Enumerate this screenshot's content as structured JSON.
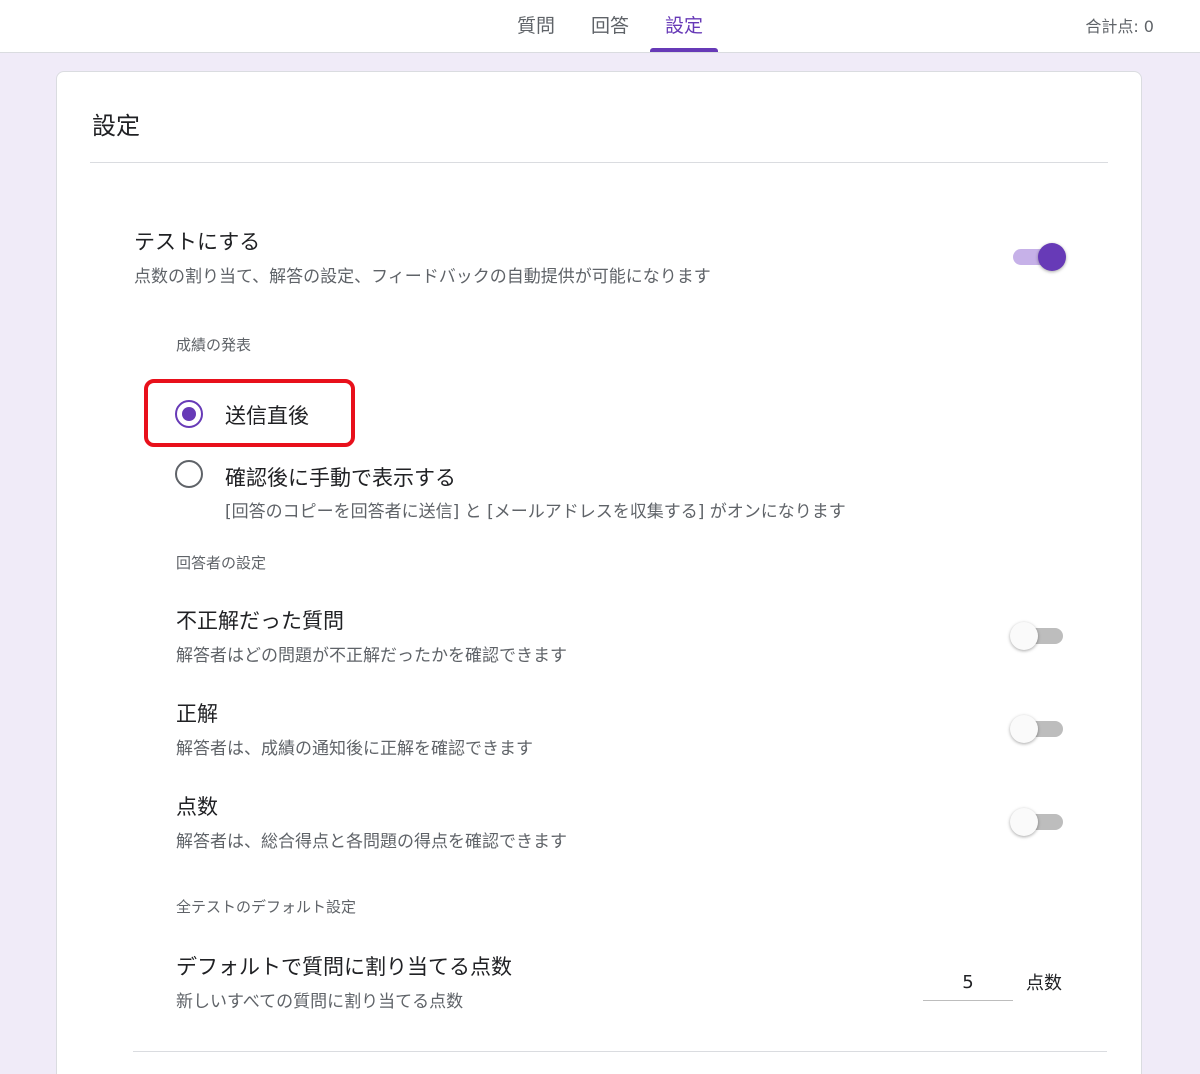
{
  "header": {
    "tabs": [
      {
        "label": "質問",
        "active": false
      },
      {
        "label": "回答",
        "active": false
      },
      {
        "label": "設定",
        "active": true
      }
    ],
    "total_points": "合計点: 0"
  },
  "settings": {
    "title": "設定",
    "quiz_mode": {
      "title": "テストにする",
      "description": "点数の割り当て、解答の設定、フィードバックの自動提供が可能になります",
      "enabled": true
    },
    "release_grade": {
      "section_label": "成績の発表",
      "options": [
        {
          "label": "送信直後",
          "selected": true,
          "description": ""
        },
        {
          "label": "確認後に手動で表示する",
          "selected": false,
          "description": "[回答のコピーを回答者に送信] と [メールアドレスを収集する] がオンになります"
        }
      ]
    },
    "respondent": {
      "section_label": "回答者の設定",
      "items": [
        {
          "title": "不正解だった質問",
          "description": "解答者はどの問題が不正解だったかを確認できます",
          "enabled": false
        },
        {
          "title": "正解",
          "description": "解答者は、成績の通知後に正解を確認できます",
          "enabled": false
        },
        {
          "title": "点数",
          "description": "解答者は、総合得点と各問題の得点を確認できます",
          "enabled": false
        }
      ]
    },
    "defaults": {
      "section_label": "全テストのデフォルト設定",
      "title": "デフォルトで質問に割り当てる点数",
      "description": "新しいすべての質問に割り当てる点数",
      "value": "5",
      "unit": "点数"
    }
  },
  "colors": {
    "accent": "#673ab7",
    "highlight": "#e8101b",
    "background": "#f0ebf8"
  }
}
